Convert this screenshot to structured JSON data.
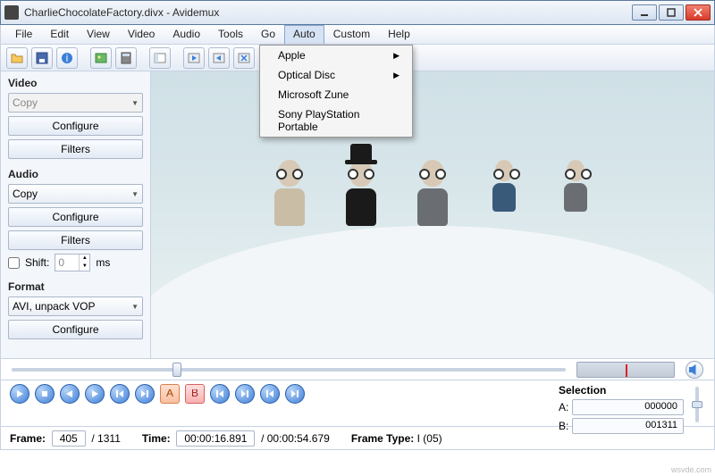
{
  "window": {
    "title": "CharlieChocolateFactory.divx - Avidemux"
  },
  "menubar": [
    "File",
    "Edit",
    "View",
    "Video",
    "Audio",
    "Tools",
    "Go",
    "Auto",
    "Custom",
    "Help"
  ],
  "menubar_open_index": 7,
  "auto_menu": [
    {
      "label": "Apple",
      "submenu": true
    },
    {
      "label": "Optical Disc",
      "submenu": true
    },
    {
      "label": "Microsoft Zune",
      "submenu": false
    },
    {
      "label": "Sony PlayStation Portable",
      "submenu": false
    }
  ],
  "toolbar_icons": [
    "open-icon",
    "save-icon",
    "info-icon",
    "picture-icon",
    "calculator-icon",
    "panel-icon",
    "seek-a-icon",
    "seek-b-icon",
    "cut-icon"
  ],
  "sidebar": {
    "video": {
      "label": "Video",
      "codec": "Copy",
      "configure": "Configure",
      "filters": "Filters"
    },
    "audio": {
      "label": "Audio",
      "codec": "Copy",
      "configure": "Configure",
      "filters": "Filters",
      "shift_label": "Shift:",
      "shift_value": "0",
      "shift_unit": "ms"
    },
    "format": {
      "label": "Format",
      "container": "AVI, unpack VOP",
      "configure": "Configure"
    }
  },
  "selection": {
    "title": "Selection",
    "a_label": "A:",
    "a_value": "000000",
    "b_label": "B:",
    "b_value": "001311"
  },
  "status": {
    "frame_label": "Frame:",
    "frame_cur": "405",
    "frame_total": "/ 1311",
    "time_label": "Time:",
    "time_cur": "00:00:16.891",
    "time_total": "/ 00:00:54.679",
    "frametype_label": "Frame Type:",
    "frametype_value": "I (05)"
  },
  "watermark": "wsvde.com"
}
